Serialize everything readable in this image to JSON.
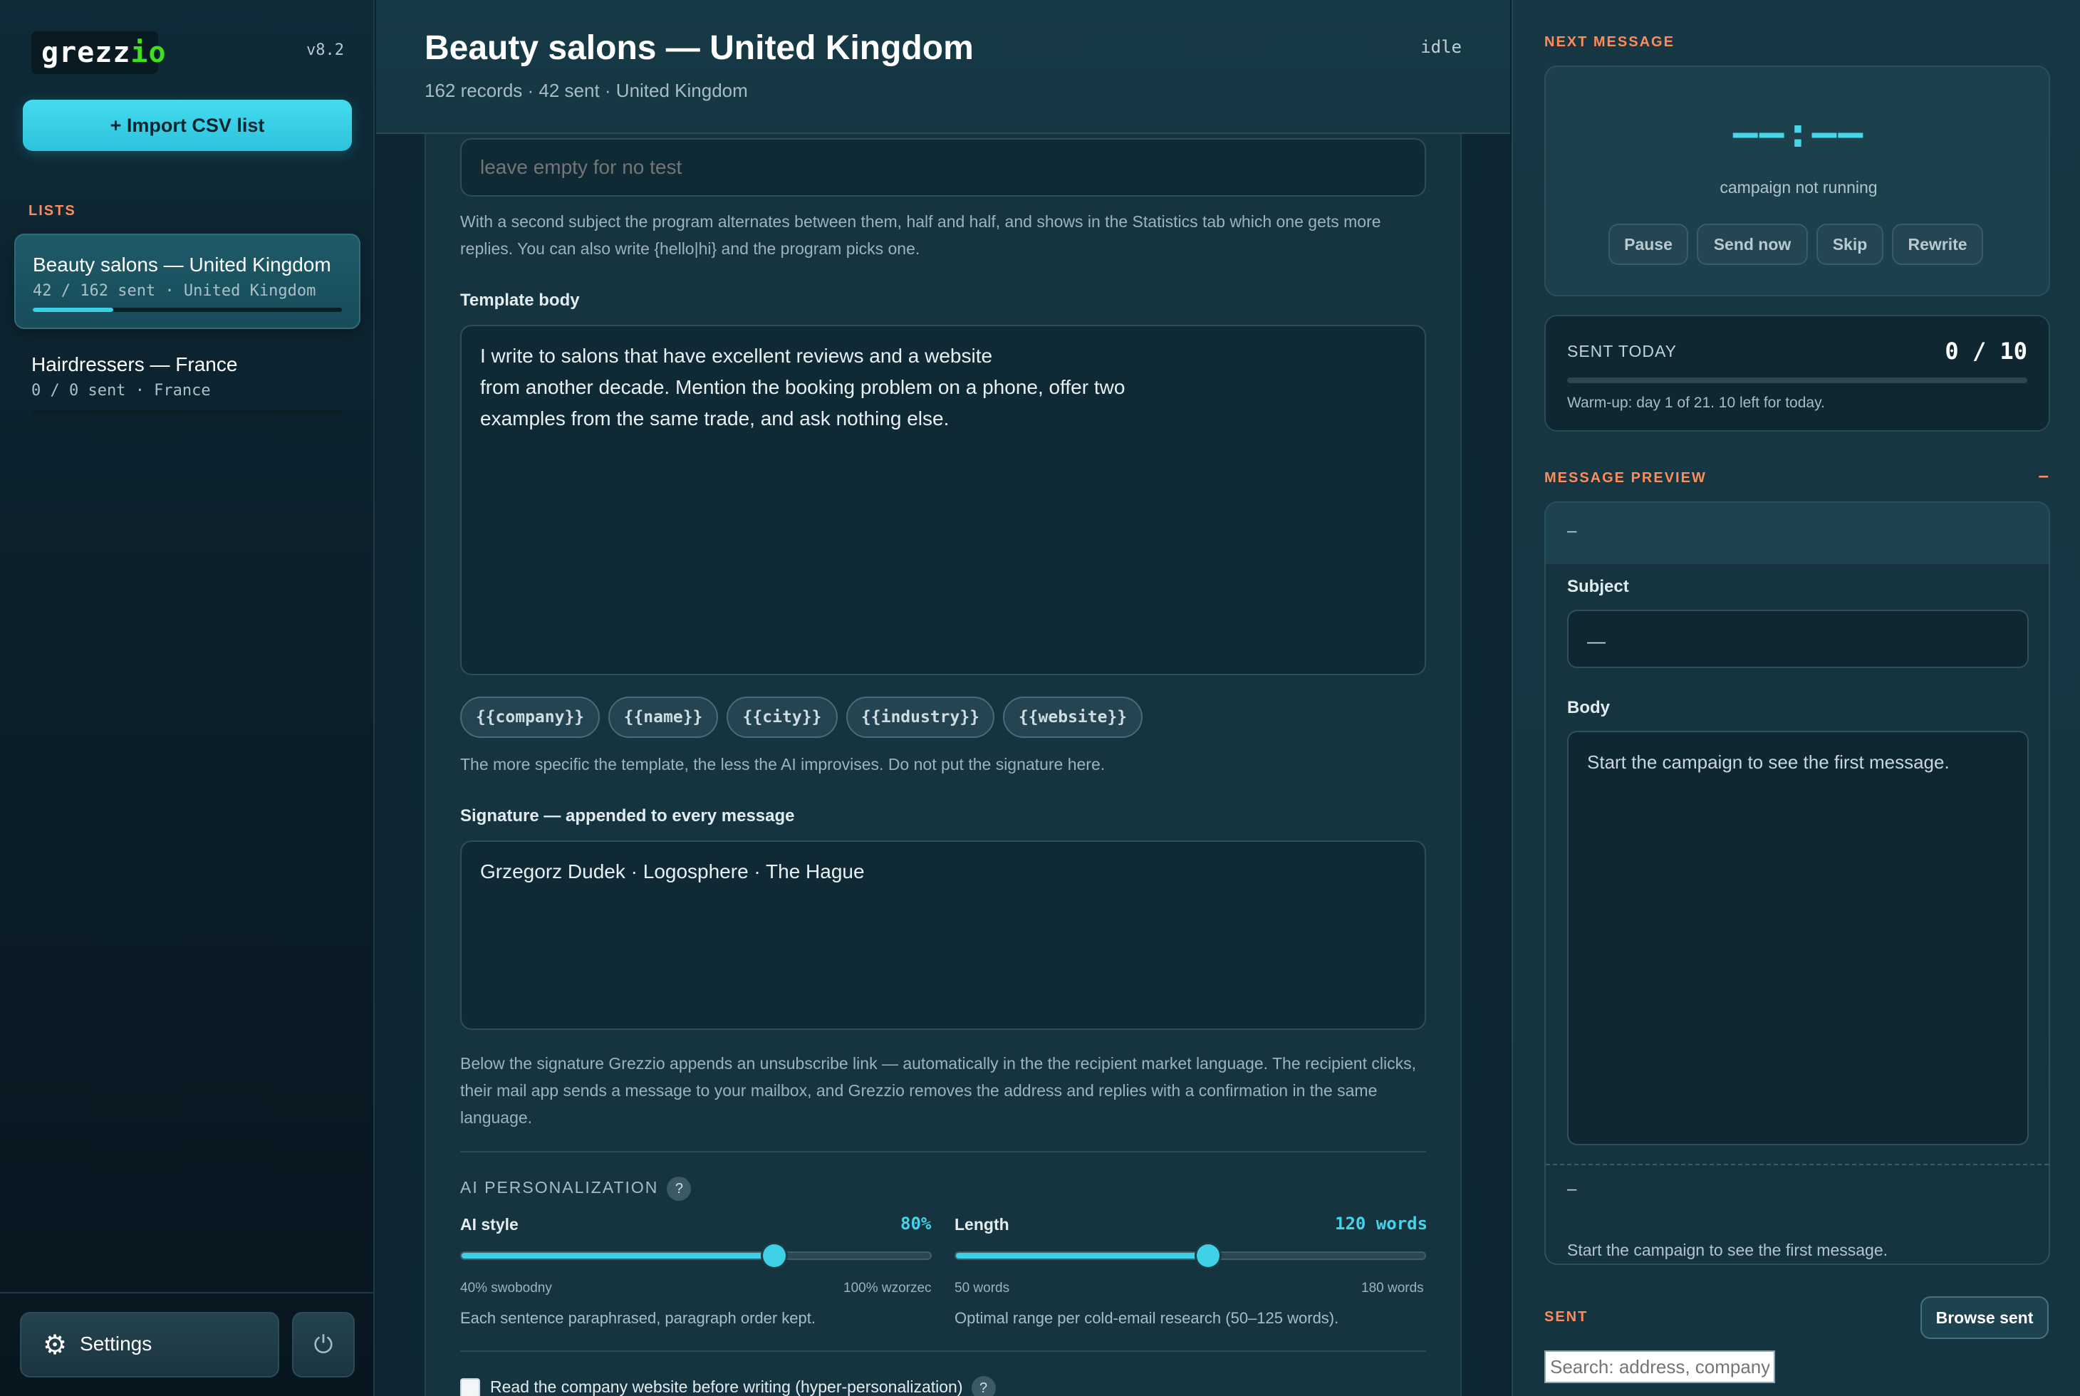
{
  "app": {
    "logo_main": "grezz",
    "logo_accent": "io",
    "version": "v8.2"
  },
  "sidebar": {
    "import_button": "+ Import CSV list",
    "lists_label": "LISTS",
    "lists": [
      {
        "name": "Beauty salons — United Kingdom",
        "meta": "42 / 162 sent · United Kingdom",
        "progress": 0.26,
        "active": true
      },
      {
        "name": "Hairdressers — France",
        "meta": "0 / 0 sent · France",
        "progress": 0,
        "active": false
      }
    ],
    "settings_label": "Settings",
    "icons": {
      "settings": "gear-icon",
      "power": "power-icon"
    }
  },
  "header": {
    "title": "Beauty salons — United Kingdom",
    "subtitle": "162 records · 42 sent · United Kingdom",
    "status": "idle"
  },
  "form": {
    "test_subject_placeholder": "leave empty for no test",
    "subject_helper": "With a second subject the program alternates between them, half and half, and shows in the Statistics tab which one gets more replies. You can also write {hello|hi} and the program picks one.",
    "template_label": "Template body",
    "template_body_lines": [
      "I write to salons that have excellent reviews and a website",
      "from another decade. Mention the booking problem on a phone, offer two",
      "examples from the same trade, and ask nothing else."
    ],
    "tokens": [
      "{{company}}",
      "{{name}}",
      "{{city}}",
      "{{industry}}",
      "{{website}}"
    ],
    "template_helper": "The more specific the template, the less the AI improvises. Do not put the signature here.",
    "signature_label": "Signature — appended to every message",
    "signature": "Grzegorz Dudek · Logosphere · The Hague",
    "signature_helper": "Below the signature Grezzio appends an unsubscribe link — automatically in the the recipient market language. The recipient clicks, their mail app sends a message to your mailbox, and Grezzio removes the address and replies with a confirmation in the same language.",
    "ai_label": "AI PERSONALIZATION",
    "ai_help": "?",
    "ai_style": {
      "label": "AI style",
      "value_text": "80%",
      "value": 80,
      "min": 40,
      "max": 100,
      "min_label": "40% swobodny",
      "max_label": "100% wzorzec",
      "desc": "Each sentence paraphrased, paragraph order kept."
    },
    "length": {
      "label": "Length",
      "value_text": "120 words",
      "value": 120,
      "min": 50,
      "max": 180,
      "min_label": "50 words",
      "max_label": "180 words",
      "desc": "Optimal range per cold-email research (50–125 words)."
    },
    "read_website_label": "Read the company website before writing (hyper-personalization)",
    "read_website_help": "?"
  },
  "right": {
    "next_label": "NEXT MESSAGE",
    "countdown": "––:––",
    "not_running": "campaign not running",
    "buttons": [
      "Pause",
      "Send now",
      "Skip",
      "Rewrite"
    ],
    "sent_today_label": "SENT TODAY",
    "sent_today_value": "0 / 10",
    "sent_today_progress": 0,
    "warmup_note": "Warm-up: day 1 of 21. 10 left for today.",
    "preview_label": "MESSAGE PREVIEW",
    "preview_collapse": "–",
    "preview_dash_top": "–",
    "subject_label": "Subject",
    "subject_value": "—",
    "body_label": "Body",
    "body_placeholder": "Start the campaign to see the first message.",
    "preview_dash_bottom": "–",
    "preview_note": "Start the campaign to see the first message.",
    "sent_label": "SENT",
    "browse_button": "Browse sent",
    "search_placeholder": "Search: address, company"
  },
  "colors": {
    "accent": "#3fd0e6",
    "section_label": "#ff8b5a",
    "logo_accent": "#3ee01f"
  }
}
